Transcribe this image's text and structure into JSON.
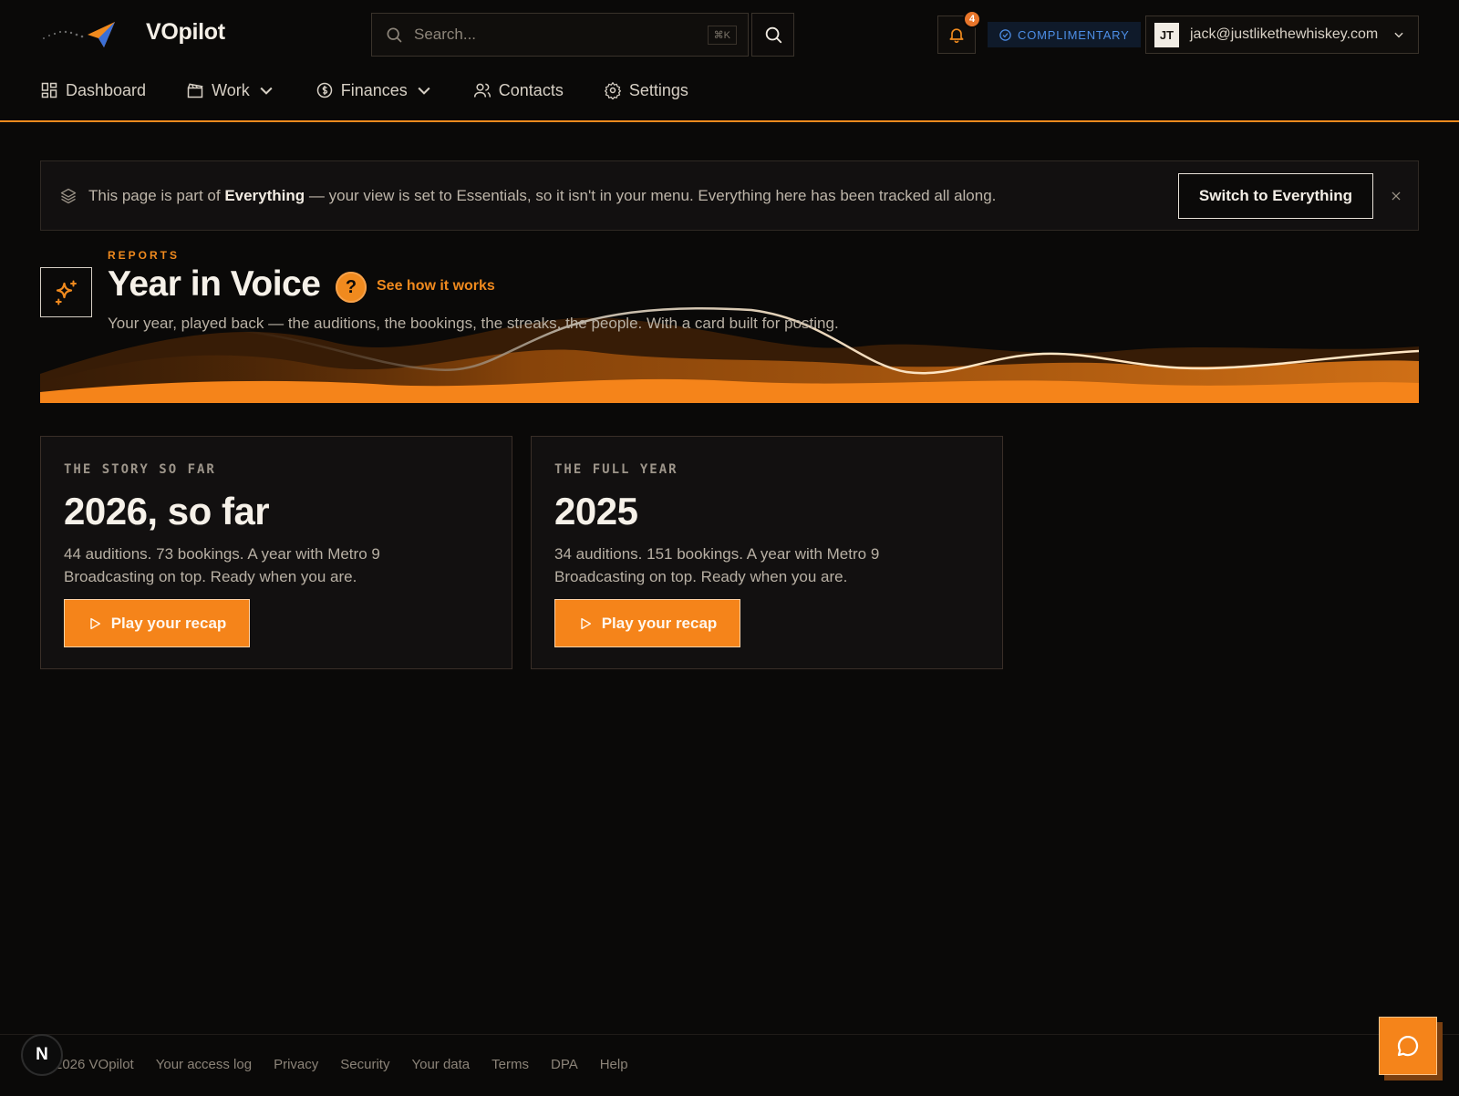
{
  "app": {
    "brand": "VOpilot"
  },
  "search": {
    "placeholder": "Search...",
    "shortcut": "⌘K"
  },
  "notifications": {
    "count": "4"
  },
  "plan_badge": {
    "label": "COMPLIMENTARY"
  },
  "account": {
    "initials": "JT",
    "email": "jack@justlikethewhiskey.com"
  },
  "nav": {
    "items": [
      {
        "label": "Dashboard",
        "icon": "grid-icon"
      },
      {
        "label": "Work",
        "icon": "clapperboard-icon",
        "dropdown": true
      },
      {
        "label": "Finances",
        "icon": "dollar-circle-icon",
        "dropdown": true
      },
      {
        "label": "Contacts",
        "icon": "users-icon"
      },
      {
        "label": "Settings",
        "icon": "gear-icon"
      }
    ]
  },
  "banner": {
    "prefix": "This page is part of ",
    "bold": "Everything",
    "suffix": " — your view is set to Essentials, so it isn't in your menu. Everything here has been tracked all along.",
    "button": "Switch to Everything"
  },
  "hero": {
    "eyebrow": "REPORTS",
    "title": "Year in Voice",
    "help_link": "See how it works",
    "subtitle": "Your year, played back — the auditions, the bookings, the streaks, the people. With a card built for posting."
  },
  "cards": [
    {
      "kicker": "THE STORY SO FAR",
      "title": "2026, so far",
      "body": "44 auditions. 73 bookings. A year with Metro 9 Broadcasting on top. Ready when you are.",
      "button": "Play your recap"
    },
    {
      "kicker": "THE FULL YEAR",
      "title": "2025",
      "body": "34 auditions. 151 bookings. A year with Metro 9 Broadcasting on top. Ready when you are.",
      "button": "Play your recap"
    }
  ],
  "footer": {
    "copyright": "2026 VOpilot",
    "links": [
      "Your access log",
      "Privacy",
      "Security",
      "Your data",
      "Terms",
      "DPA",
      "Help"
    ]
  },
  "dev_badge": {
    "letter": "N"
  },
  "colors": {
    "accent": "#f08a1e",
    "background": "#0a0908",
    "plan_blue": "#4d8ee6"
  }
}
